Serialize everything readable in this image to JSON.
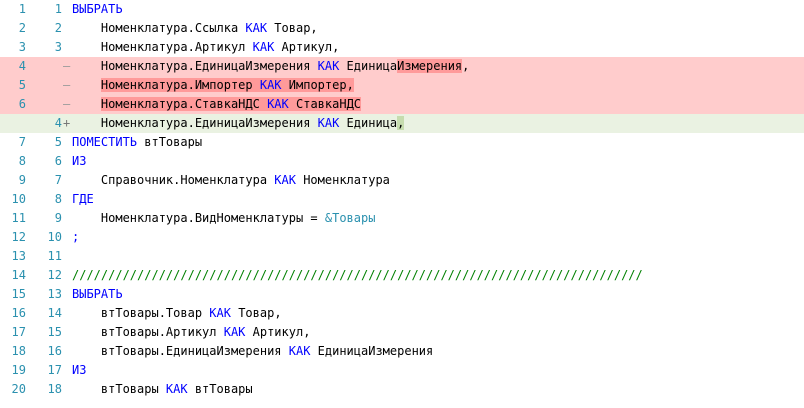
{
  "lines": [
    {
      "old": "1",
      "new": "1",
      "type": "ctx",
      "tokens": [
        {
          "t": "ВЫБРАТЬ",
          "c": "kw"
        }
      ]
    },
    {
      "old": "2",
      "new": "2",
      "type": "ctx",
      "tokens": [
        {
          "t": "    Номенклатура.Ссылка "
        },
        {
          "t": "КАК",
          "c": "kw"
        },
        {
          "t": " Товар,"
        }
      ]
    },
    {
      "old": "3",
      "new": "3",
      "type": "ctx",
      "tokens": [
        {
          "t": "    Номенклатура.Артикул "
        },
        {
          "t": "КАК",
          "c": "kw"
        },
        {
          "t": " Артикул,"
        }
      ]
    },
    {
      "old": "4",
      "new": "",
      "type": "del",
      "mark": "—",
      "tokens": [
        {
          "t": "    Номенклатура.ЕдиницаИзмерения "
        },
        {
          "t": "КАК",
          "c": "kw"
        },
        {
          "t": " Единица"
        },
        {
          "t": "Измерения",
          "c": "hl-del"
        },
        {
          "t": ","
        }
      ]
    },
    {
      "old": "5",
      "new": "",
      "type": "del",
      "mark": "—",
      "tokens": [
        {
          "t": "    "
        },
        {
          "t": "Номенклатура.Импортер ",
          "c": "hl-del"
        },
        {
          "t": "КАК",
          "c": "kw hl-del"
        },
        {
          "t": " Импортер,",
          "c": "hl-del"
        }
      ]
    },
    {
      "old": "6",
      "new": "",
      "type": "del",
      "mark": "—",
      "tokens": [
        {
          "t": "    "
        },
        {
          "t": "Номенклатура.СтавкаНДС ",
          "c": "hl-del"
        },
        {
          "t": "КАК",
          "c": "kw hl-del"
        },
        {
          "t": " СтавкаНДС",
          "c": "hl-del"
        }
      ]
    },
    {
      "old": "",
      "new": "4",
      "type": "add",
      "mark": "+",
      "tokens": [
        {
          "t": "    Номенклатура.ЕдиницаИзмерения "
        },
        {
          "t": "КАК",
          "c": "kw"
        },
        {
          "t": " Единица"
        },
        {
          "t": ",",
          "c": "hl-add"
        }
      ]
    },
    {
      "old": "7",
      "new": "5",
      "type": "ctx",
      "tokens": [
        {
          "t": "ПОМЕСТИТЬ",
          "c": "kw"
        },
        {
          "t": " втТовары"
        }
      ]
    },
    {
      "old": "8",
      "new": "6",
      "type": "ctx",
      "tokens": [
        {
          "t": "ИЗ",
          "c": "kw"
        }
      ]
    },
    {
      "old": "9",
      "new": "7",
      "type": "ctx",
      "tokens": [
        {
          "t": "    Справочник.Номенклатура "
        },
        {
          "t": "КАК",
          "c": "kw"
        },
        {
          "t": " Номенклатура"
        }
      ]
    },
    {
      "old": "10",
      "new": "8",
      "type": "ctx",
      "tokens": [
        {
          "t": "ГДЕ",
          "c": "kw"
        }
      ]
    },
    {
      "old": "11",
      "new": "9",
      "type": "ctx",
      "tokens": [
        {
          "t": "    Номенклатура.ВидНоменклатуры = "
        },
        {
          "t": "&Товары",
          "c": "pm"
        }
      ]
    },
    {
      "old": "12",
      "new": "10",
      "type": "ctx",
      "tokens": [
        {
          "t": ";",
          "c": "kw"
        }
      ]
    },
    {
      "old": "13",
      "new": "11",
      "type": "ctx",
      "tokens": []
    },
    {
      "old": "14",
      "new": "12",
      "type": "ctx",
      "tokens": [
        {
          "t": "///////////////////////////////////////////////////////////////////////////////",
          "c": "cm"
        }
      ]
    },
    {
      "old": "15",
      "new": "13",
      "type": "ctx",
      "tokens": [
        {
          "t": "ВЫБРАТЬ",
          "c": "kw"
        }
      ]
    },
    {
      "old": "16",
      "new": "14",
      "type": "ctx",
      "tokens": [
        {
          "t": "    втТовары.Товар "
        },
        {
          "t": "КАК",
          "c": "kw"
        },
        {
          "t": " Товар,"
        }
      ]
    },
    {
      "old": "17",
      "new": "15",
      "type": "ctx",
      "tokens": [
        {
          "t": "    втТовары.Артикул "
        },
        {
          "t": "КАК",
          "c": "kw"
        },
        {
          "t": " Артикул,"
        }
      ]
    },
    {
      "old": "18",
      "new": "16",
      "type": "ctx",
      "tokens": [
        {
          "t": "    втТовары.ЕдиницаИзмерения "
        },
        {
          "t": "КАК",
          "c": "kw"
        },
        {
          "t": " ЕдиницаИзмерения"
        }
      ]
    },
    {
      "old": "19",
      "new": "17",
      "type": "ctx",
      "tokens": [
        {
          "t": "ИЗ",
          "c": "kw"
        }
      ]
    },
    {
      "old": "20",
      "new": "18",
      "type": "ctx",
      "tokens": [
        {
          "t": "    втТовары "
        },
        {
          "t": "КАК",
          "c": "kw"
        },
        {
          "t": " втТовары"
        }
      ]
    }
  ]
}
